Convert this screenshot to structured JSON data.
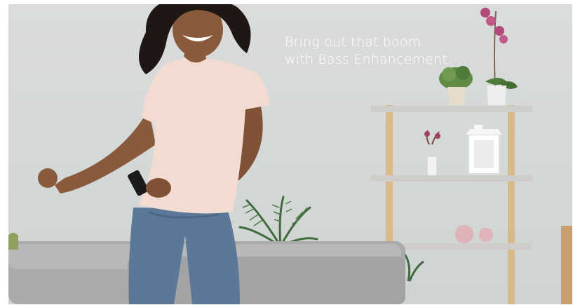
{
  "banner": {
    "headline_line1": "Bring out that boom",
    "headline_line2": "with Bass Enhancement."
  },
  "colors": {
    "wall": "#d7dbd8",
    "headline": "#ffffff",
    "shirt": "#f2dcd2",
    "jeans": "#5d7a9a",
    "sofa": "#a7a9aa",
    "shelf_wood": "#d8b98a"
  }
}
